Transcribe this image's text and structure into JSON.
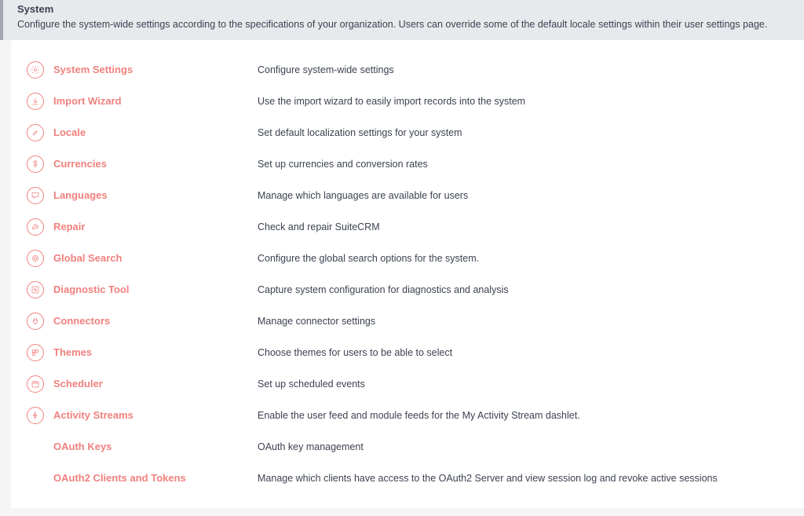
{
  "section": {
    "title": "System",
    "description": "Configure the system-wide settings according to the specifications of your organization. Users can override some of the default locale settings within their user settings page."
  },
  "items": [
    {
      "label": "System Settings",
      "description": "Configure system-wide settings",
      "icon": "gear"
    },
    {
      "label": "Import Wizard",
      "description": "Use the import wizard to easily import records into the system",
      "icon": "download"
    },
    {
      "label": "Locale",
      "description": "Set default localization settings for your system",
      "icon": "compass"
    },
    {
      "label": "Currencies",
      "description": "Set up currencies and conversion rates",
      "icon": "dollar"
    },
    {
      "label": "Languages",
      "description": "Manage which languages are available for users",
      "icon": "chat"
    },
    {
      "label": "Repair",
      "description": "Check and repair SuiteCRM",
      "icon": "wrench"
    },
    {
      "label": "Global Search",
      "description": "Configure the global search options for the system.",
      "icon": "target"
    },
    {
      "label": "Diagnostic Tool",
      "description": "Capture system configuration for diagnostics and analysis",
      "icon": "pulse"
    },
    {
      "label": "Connectors",
      "description": "Manage connector settings",
      "icon": "plug"
    },
    {
      "label": "Themes",
      "description": "Choose themes for users to be able to select",
      "icon": "palette"
    },
    {
      "label": "Scheduler",
      "description": "Set up scheduled events",
      "icon": "calendar"
    },
    {
      "label": "Activity Streams",
      "description": "Enable the user feed and module feeds for the My Activity Stream dashlet.",
      "icon": "bolt"
    },
    {
      "label": "OAuth Keys",
      "description": "OAuth key management",
      "icon": ""
    },
    {
      "label": "OAuth2 Clients and Tokens",
      "description": "Manage which clients have access to the OAuth2 Server and view session log and revoke active sessions",
      "icon": ""
    }
  ]
}
